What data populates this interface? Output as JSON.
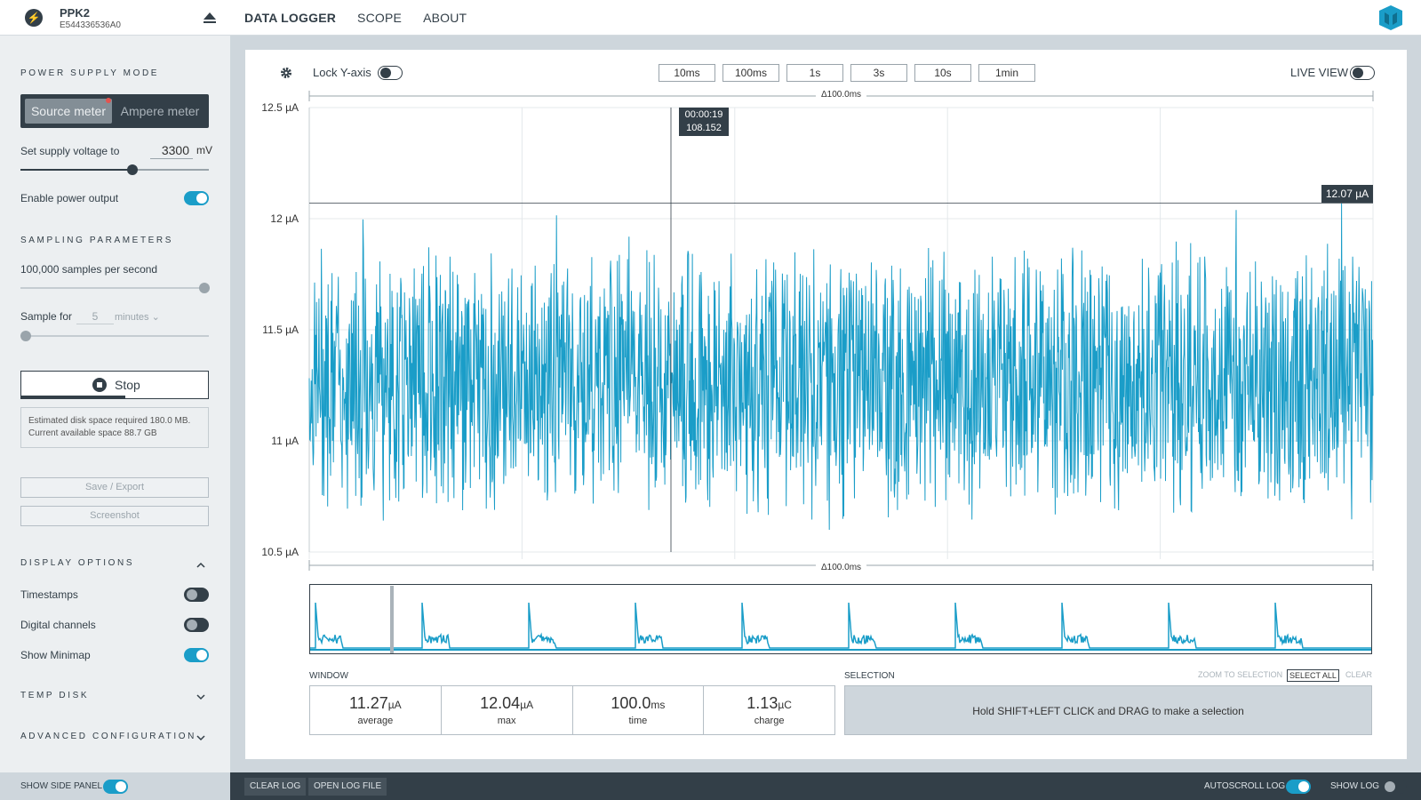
{
  "device": {
    "name": "PPK2",
    "serial": "E544336536A0"
  },
  "nav": {
    "tabs": [
      "DATA LOGGER",
      "SCOPE",
      "ABOUT"
    ]
  },
  "side": {
    "power_supply_title": "POWER SUPPLY MODE",
    "source_meter": "Source meter",
    "ampere_meter": "Ampere meter",
    "set_voltage_label": "Set supply voltage to",
    "voltage_value": "3300",
    "voltage_unit": "mV",
    "voltage_slider_fraction": 0.59,
    "enable_power_label": "Enable power output",
    "enable_power_on": true,
    "sampling_title": "SAMPLING PARAMETERS",
    "samples_label": "100,000 samples per second",
    "sample_for_label": "Sample for",
    "sample_for_value": "5",
    "sample_for_unit": "minutes",
    "stop_label": "Stop",
    "disk_required": "Estimated disk space required 180.0 MB.",
    "disk_available": "Current available space 88.7 GB",
    "save_export": "Save / Export",
    "screenshot": "Screenshot",
    "display_options_title": "DISPLAY OPTIONS",
    "timestamps": "Timestamps",
    "digital_channels": "Digital channels",
    "show_minimap": "Show Minimap",
    "temp_disk_title": "TEMP DISK",
    "advanced_title": "ADVANCED CONFIGURATION"
  },
  "toolbar": {
    "lock_y_axis": "Lock Y-axis",
    "windows": [
      "10ms",
      "100ms",
      "1s",
      "3s",
      "10s",
      "1min"
    ],
    "live_view": "LIVE VIEW"
  },
  "chart_data": {
    "type": "line",
    "y_ticks": [
      "12.5 µA",
      "12 µA",
      "11.5 µA",
      "11 µA",
      "10.5 µA"
    ],
    "ylim": [
      10.5,
      12.5
    ],
    "delta_top": "Δ100.0ms",
    "delta_bottom": "Δ100.0ms",
    "cursor_time": "00:00:19",
    "cursor_value": "108.152",
    "max_marker": "12.07 µA",
    "max_value": 12.07,
    "mean": 11.27,
    "series_color": "#1a9dc8"
  },
  "stats": {
    "window_title": "WINDOW",
    "selection_title": "SELECTION",
    "cells": [
      {
        "value": "11.27",
        "unit": "µA",
        "name": "average"
      },
      {
        "value": "12.04",
        "unit": "µA",
        "name": "max"
      },
      {
        "value": "100.0",
        "unit": "ms",
        "name": "time"
      },
      {
        "value": "1.13",
        "unit": "µC",
        "name": "charge"
      }
    ],
    "zoom_to_selection": "ZOOM TO SELECTION",
    "select_all": "SELECT ALL",
    "clear": "CLEAR",
    "selection_hint": "Hold SHIFT+LEFT CLICK and DRAG to make a selection"
  },
  "bottom": {
    "show_side_panel": "SHOW SIDE PANEL",
    "clear_log": "CLEAR LOG",
    "open_log_file": "OPEN LOG FILE",
    "autoscroll_log": "AUTOSCROLL LOG",
    "show_log": "SHOW LOG"
  },
  "colors": {
    "accent": "#1a9dc8",
    "dark": "#333f48"
  }
}
